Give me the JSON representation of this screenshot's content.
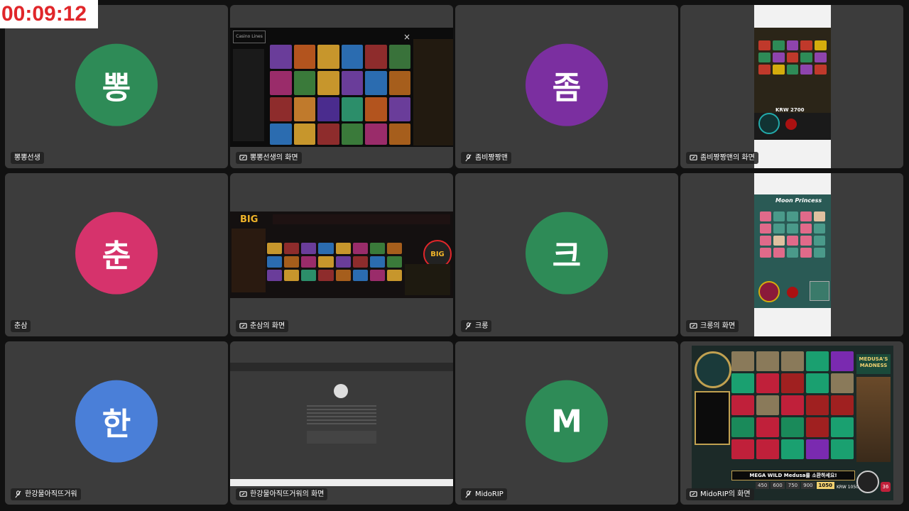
{
  "timer": "00:09:12",
  "colors": {
    "tile_bg": "#3c3c3c",
    "page_bg": "#111111",
    "timer_text": "#e0262a"
  },
  "participants": [
    {
      "avatar_text": "뽕",
      "color": "#2e8b57",
      "name": "뽕뽕선생",
      "mic": "on",
      "share_label": "뽕뽕선생의 화면"
    },
    {
      "avatar_text": "좀",
      "color": "#7b2fa0",
      "name": "좀비짱짱맨",
      "mic": "muted",
      "share_label": "좀비짱짱맨의 화면"
    },
    {
      "avatar_text": "춘",
      "color": "#d6336c",
      "name": "춘삼",
      "mic": "on",
      "share_label": "춘삼의 화면"
    },
    {
      "avatar_text": "크",
      "color": "#2e8b57",
      "name": "크롱",
      "mic": "muted",
      "share_label": "크롱의 화면"
    },
    {
      "avatar_text": "한",
      "color": "#4a7fd8",
      "name": "한강물아직뜨거워",
      "mic": "muted",
      "share_label": "한강물아직뜨거워의 화면"
    },
    {
      "avatar_text": "M",
      "color": "#2e8b57",
      "name": "MidoRIP",
      "mic": "muted",
      "share_label": "MidoRIP의 화면"
    }
  ],
  "screens": {
    "casino_logo": "Casino Lines",
    "bigg_logo": "BIG",
    "krw_balance_1": "KRW 2700",
    "moon_title": "Moon Princess",
    "medusa_title": "MEDUSA'S MADNESS",
    "medusa_banner": "MEGA WILD Medusa를 소환하세요!",
    "bet_options": [
      "450",
      "600",
      "750",
      "900",
      "1050"
    ],
    "bet_selected": "1050",
    "krw_bet": "KRW 1050",
    "reel_count": "36"
  }
}
